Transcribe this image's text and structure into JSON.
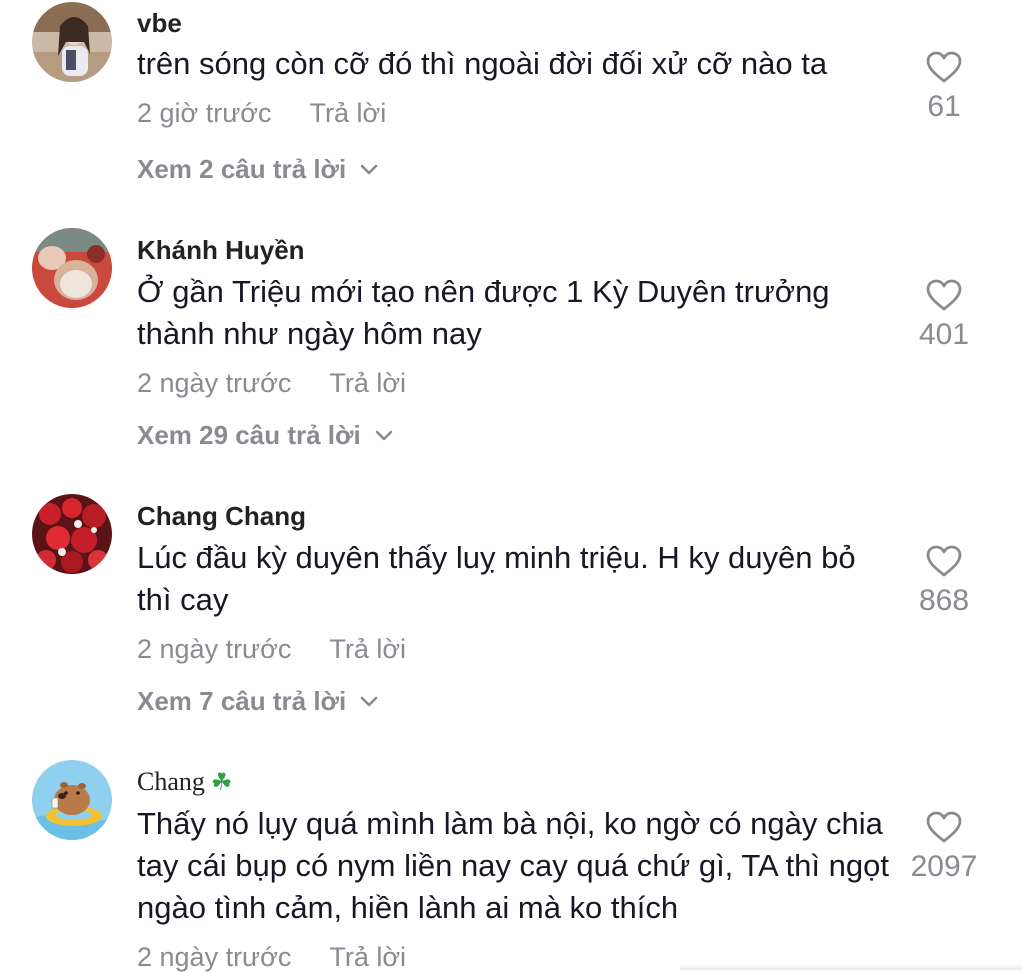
{
  "comments": [
    {
      "username": "vbe",
      "text": "trên sóng còn cỡ đó thì ngoài đời đối xử cỡ nào ta",
      "time": "2 giờ trước",
      "reply_label": "Trả lời",
      "view_replies": "Xem 2 câu trả lời",
      "likes": "61"
    },
    {
      "username": "Khánh Huyền",
      "text": "Ở gần Triệu mới tạo nên được 1 Kỳ Duyên trưởng thành như ngày hôm nay",
      "time": "2 ngày trước",
      "reply_label": "Trả lời",
      "view_replies": "Xem 29 câu trả lời",
      "likes": "401"
    },
    {
      "username": "Chang Chang",
      "text": "Lúc đầu kỳ duyên thấy luỵ minh triệu. H ky duyên bỏ thì cay",
      "time": "2 ngày trước",
      "reply_label": "Trả lời",
      "view_replies": "Xem 7 câu trả lời",
      "likes": "868"
    },
    {
      "username": "Chang",
      "username_emoji": "☘",
      "text": "Thấy nó lụy quá mình làm bà nội, ko ngờ có ngày chia tay cái bụp có nym liền nay cay quá chứ gì, TA thì ngọt ngào tình cảm, hiền lành ai mà ko thích",
      "time": "2 ngày trước",
      "reply_label": "Trả lời",
      "likes": "2097"
    }
  ],
  "icons": {
    "like": "heart-outline-icon",
    "expand": "chevron-down-icon"
  },
  "colors": {
    "text": "#161823",
    "muted": "#8a8b91",
    "background": "#ffffff"
  }
}
